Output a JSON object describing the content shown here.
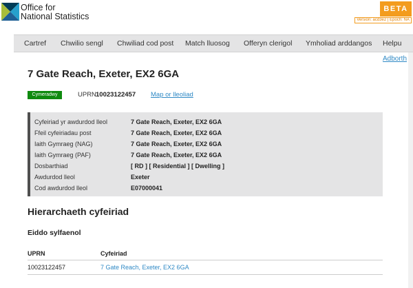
{
  "header": {
    "logo_line1": "Office for",
    "logo_line2": "National Statistics",
    "beta_label": "BETA",
    "version_text": "Version: acd3e2 | Epoch: NA",
    "logo_colors": [
      "#003c57",
      "#a8bd3a",
      "#27a0cc",
      "#206095"
    ]
  },
  "nav": {
    "items": [
      {
        "label": "Cartref"
      },
      {
        "label": "Chwilio sengl"
      },
      {
        "label": "Chwiliad cod post"
      },
      {
        "label": "Match lluosog"
      },
      {
        "label": "Offeryn clerigol"
      },
      {
        "label": "Ymholiad arddangos"
      },
      {
        "label": "Helpu"
      }
    ]
  },
  "adborth_link": "Adborth",
  "address": {
    "title": "7 Gate Reach, Exeter, EX2 6GA",
    "status_badge": "Cymeradwy",
    "uprn_label": "UPRN",
    "uprn_value": "10023122457",
    "map_link": "Map or lleoliad"
  },
  "details": [
    {
      "label": "Cyfeiriad yr awdurdod lleol",
      "value": "7 Gate Reach, Exeter, EX2 6GA"
    },
    {
      "label": "Ffeil cyfeiriadau post",
      "value": "7 Gate Reach, Exeter, EX2 6GA"
    },
    {
      "label": "Iaith Gymraeg (NAG)",
      "value": "7 Gate Reach, Exeter, EX2 6GA"
    },
    {
      "label": "Iaith Gymraeg (PAF)",
      "value": "7 Gate Reach, Exeter, EX2 6GA"
    },
    {
      "label": "Dosbarthiad",
      "value": "[ RD ] [ Residential ] [ Dwelling ]"
    },
    {
      "label": "Awdurdod lleol",
      "value": "Exeter"
    },
    {
      "label": "Cod awdurdod lleol",
      "value": "E07000041"
    }
  ],
  "hierarchy": {
    "title": "Hierarchaeth cyfeiriad",
    "subtitle": "Eiddo sylfaenol",
    "columns": [
      "UPRN",
      "Cyfeiriad"
    ],
    "rows": [
      {
        "uprn": "10023122457",
        "address": "7 Gate Reach, Exeter, EX2 6GA"
      }
    ]
  }
}
